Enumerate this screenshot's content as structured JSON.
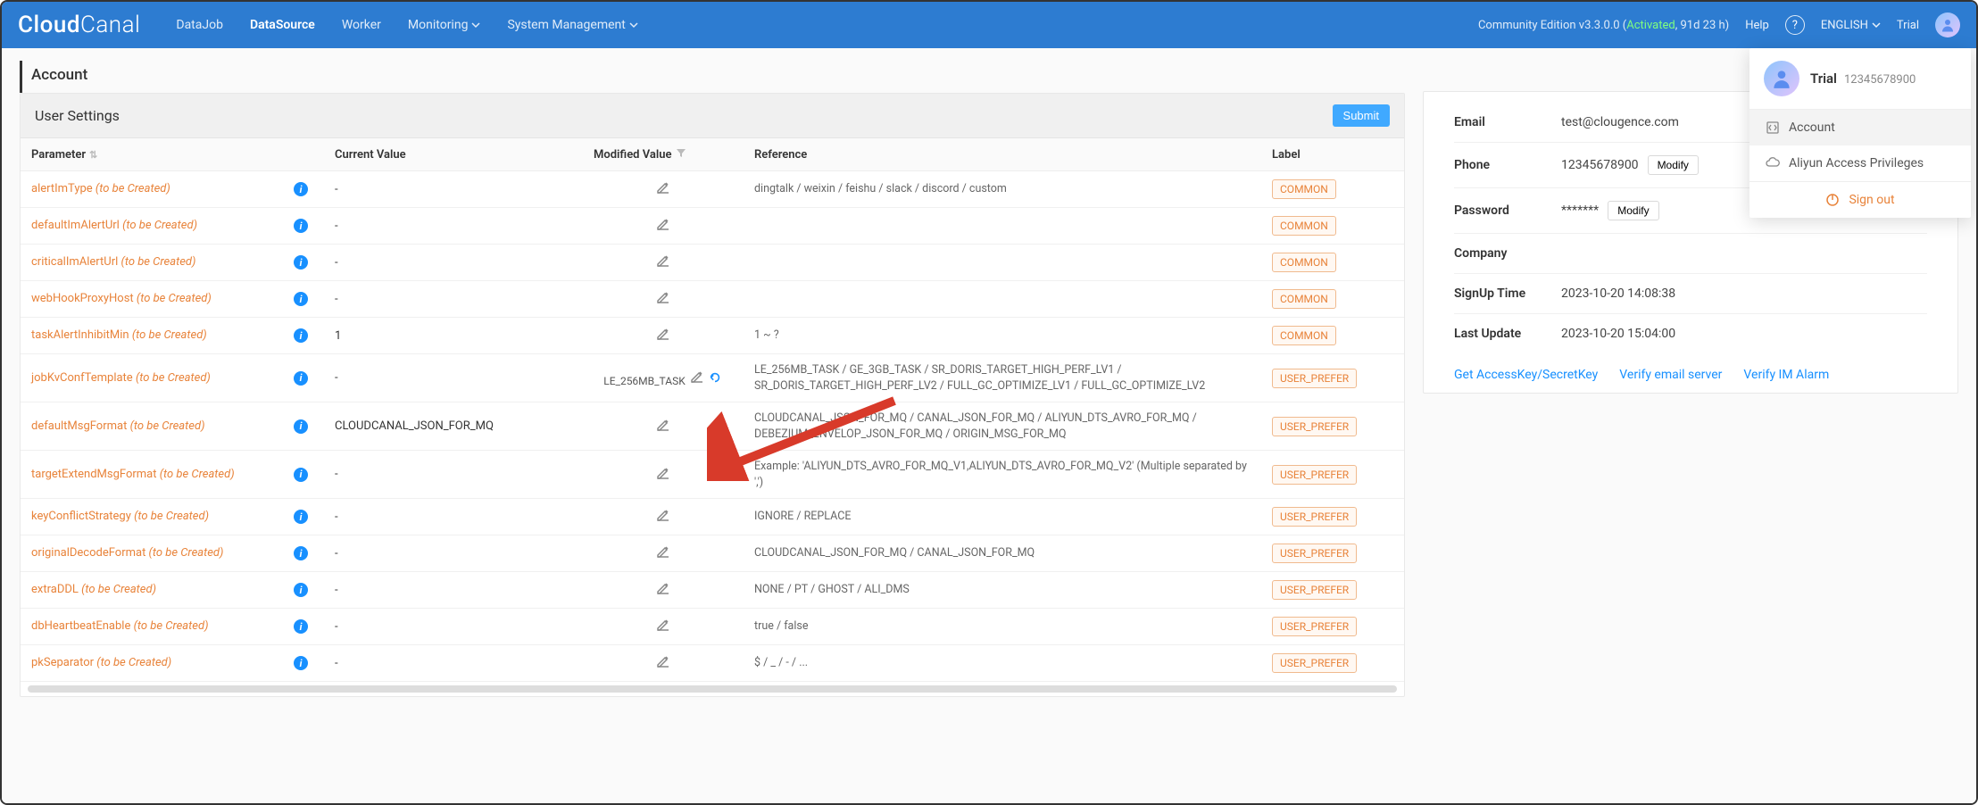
{
  "header": {
    "logo_a": "Cloud",
    "logo_b": "Canal",
    "nav": [
      "DataJob",
      "DataSource",
      "Worker",
      "Monitoring",
      "System Management"
    ],
    "version_pre": "Community Edition v3.3.0.0  (",
    "activated": "Activated",
    "version_post": ", 91d 23 h)",
    "help": "Help",
    "lang": "ENGLISH",
    "trial": "Trial"
  },
  "page_title": "Account",
  "settings": {
    "title": "User Settings",
    "submit": "Submit",
    "cols": {
      "param": "Parameter",
      "cur": "Current Value",
      "mod": "Modified Value",
      "ref": "Reference",
      "label": "Label"
    },
    "tbc": "(to be Created)",
    "rows": [
      {
        "name": "alertImType",
        "cur": "-",
        "mod": "",
        "ref": "dingtalk / weixin / feishu / slack / discord / custom",
        "label": "COMMON"
      },
      {
        "name": "defaultImAlertUrl",
        "cur": "-",
        "mod": "",
        "ref": "",
        "label": "COMMON"
      },
      {
        "name": "criticalImAlertUrl",
        "cur": "-",
        "mod": "",
        "ref": "",
        "label": "COMMON"
      },
      {
        "name": "webHookProxyHost",
        "cur": "-",
        "mod": "",
        "ref": "",
        "label": "COMMON"
      },
      {
        "name": "taskAlertInhibitMin",
        "cur": "1",
        "mod": "",
        "ref": "1 ~ ?",
        "label": "COMMON"
      },
      {
        "name": "jobKvConfTemplate",
        "cur": "-",
        "mod": "LE_256MB_TASK",
        "ref": "LE_256MB_TASK / GE_3GB_TASK / SR_DORIS_TARGET_HIGH_PERF_LV1 / SR_DORIS_TARGET_HIGH_PERF_LV2 / FULL_GC_OPTIMIZE_LV1 / FULL_GC_OPTIMIZE_LV2",
        "label": "USER_PREFER",
        "revert": true
      },
      {
        "name": "defaultMsgFormat",
        "cur": "CLOUDCANAL_JSON_FOR_MQ",
        "mod": "",
        "ref": "CLOUDCANAL_JSON_FOR_MQ / CANAL_JSON_FOR_MQ / ALIYUN_DTS_AVRO_FOR_MQ / DEBEZIUM_ENVELOP_JSON_FOR_MQ / ORIGIN_MSG_FOR_MQ",
        "label": "USER_PREFER"
      },
      {
        "name": "targetExtendMsgFormat",
        "cur": "-",
        "mod": "",
        "ref": "Example: 'ALIYUN_DTS_AVRO_FOR_MQ_V1,ALIYUN_DTS_AVRO_FOR_MQ_V2' (Multiple separated by ',')",
        "label": "USER_PREFER"
      },
      {
        "name": "keyConflictStrategy",
        "cur": "-",
        "mod": "",
        "ref": "IGNORE / REPLACE",
        "label": "USER_PREFER"
      },
      {
        "name": "originalDecodeFormat",
        "cur": "-",
        "mod": "",
        "ref": "CLOUDCANAL_JSON_FOR_MQ / CANAL_JSON_FOR_MQ",
        "label": "USER_PREFER"
      },
      {
        "name": "extraDDL",
        "cur": "-",
        "mod": "",
        "ref": "NONE / PT / GHOST / ALI_DMS",
        "label": "USER_PREFER"
      },
      {
        "name": "dbHeartbeatEnable",
        "cur": "-",
        "mod": "",
        "ref": "true / false",
        "label": "USER_PREFER"
      },
      {
        "name": "pkSeparator",
        "cur": "-",
        "mod": "",
        "ref": "$ / _ / - / ...",
        "label": "USER_PREFER"
      }
    ]
  },
  "profile": {
    "rows": [
      {
        "label": "Email",
        "val": "test@clougence.com"
      },
      {
        "label": "Phone",
        "val": "12345678900",
        "mod": true
      },
      {
        "label": "Password",
        "val": "*******",
        "mod": true
      },
      {
        "label": "Company",
        "val": ""
      },
      {
        "label": "SignUp Time",
        "val": "2023-10-20 14:08:38"
      },
      {
        "label": "Last Update",
        "val": "2023-10-20 15:04:00"
      }
    ],
    "modify": "Modify",
    "links": [
      "Get AccessKey/SecretKey",
      "Verify email server",
      "Verify IM Alarm"
    ]
  },
  "dropdown": {
    "name": "Trial",
    "phone": "12345678900",
    "items": [
      "Account",
      "Aliyun Access Privileges"
    ],
    "signout": "Sign out"
  }
}
